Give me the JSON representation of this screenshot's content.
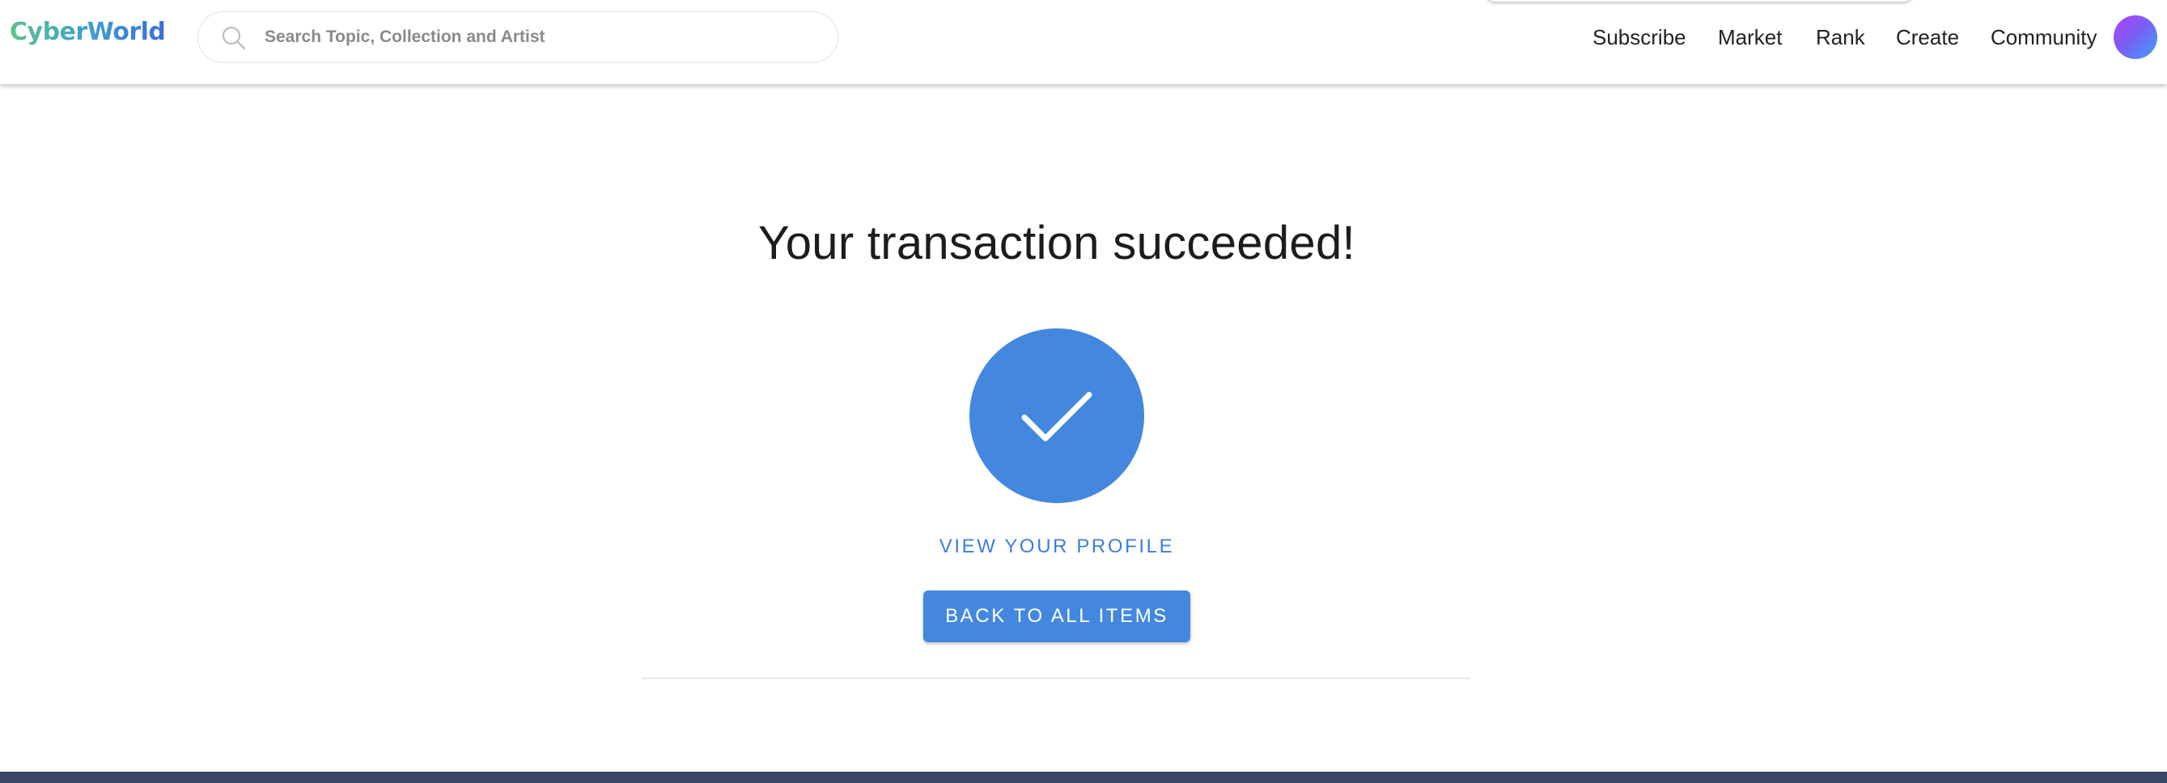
{
  "header": {
    "logo_text": "CyberWorld",
    "search": {
      "placeholder": "Search Topic, Collection and Artist",
      "value": ""
    },
    "nav_items": [
      "Subscribe",
      "Market",
      "Rank",
      "Create",
      "Community"
    ],
    "avatar_icon": "user-avatar"
  },
  "main": {
    "title": "Your transaction succeeded!",
    "status_icon": "check-circle-icon",
    "profile_link": "VIEW YOUR PROFILE",
    "back_button": "BACK TO ALL ITEMS"
  },
  "colors": {
    "accent": "#4487df",
    "link": "#3d7fd8",
    "footer": "#3a4a66"
  }
}
